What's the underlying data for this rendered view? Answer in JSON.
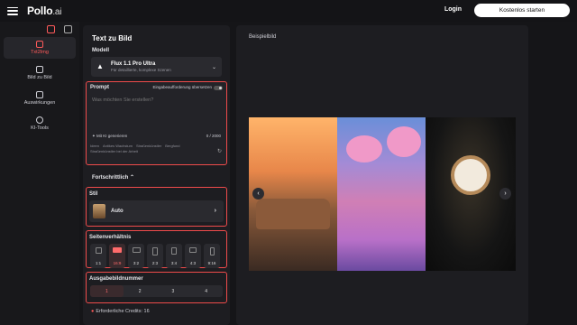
{
  "brand": {
    "name": "Pollo",
    "suffix": ".ai"
  },
  "header": {
    "login": "Login",
    "cta": "Kostenlos starten"
  },
  "rail": [
    {
      "label": "Txt2Img",
      "active": true
    },
    {
      "label": "Bild zu Bild"
    },
    {
      "label": "Auswirkungen"
    },
    {
      "label": "KI-Tools"
    }
  ],
  "panel": {
    "title": "Text zu Bild",
    "model_label": "Modell",
    "model_name": "Flux 1.1 Pro Ultra",
    "model_desc": "Für detaillierte, komplexe Szenen",
    "prompt_label": "Prompt",
    "translate_label": "Eingabeaufforderung übersetzen",
    "prompt_placeholder": "Was möchten Sie erstellen?",
    "ai_generate": "Mit KI generieren",
    "char_count": "0 / 2000",
    "tags": [
      "Ideen",
      "Antikes Wachstum",
      "Straßenkünstler",
      "Bergfund",
      "Straßenkünstler bei der Arbeit"
    ],
    "advanced": "Fortschrittlich",
    "style_label": "Stil",
    "style_value": "Auto",
    "aspect_label": "Seitenverhältnis",
    "aspects": [
      "1:1",
      "16:9",
      "3:2",
      "2:3",
      "3:4",
      "4:3",
      "9:16"
    ],
    "aspect_selected": "16:9",
    "output_label": "Ausgabebildnummer",
    "outputs": [
      "1",
      "2",
      "3",
      "4"
    ],
    "credits": "Erforderliche Credits: 16"
  },
  "gallery": {
    "title": "Beispielbild"
  },
  "colors": {
    "accent": "#ef4b4b",
    "bg": "#151518",
    "panel": "#1d1d21"
  }
}
